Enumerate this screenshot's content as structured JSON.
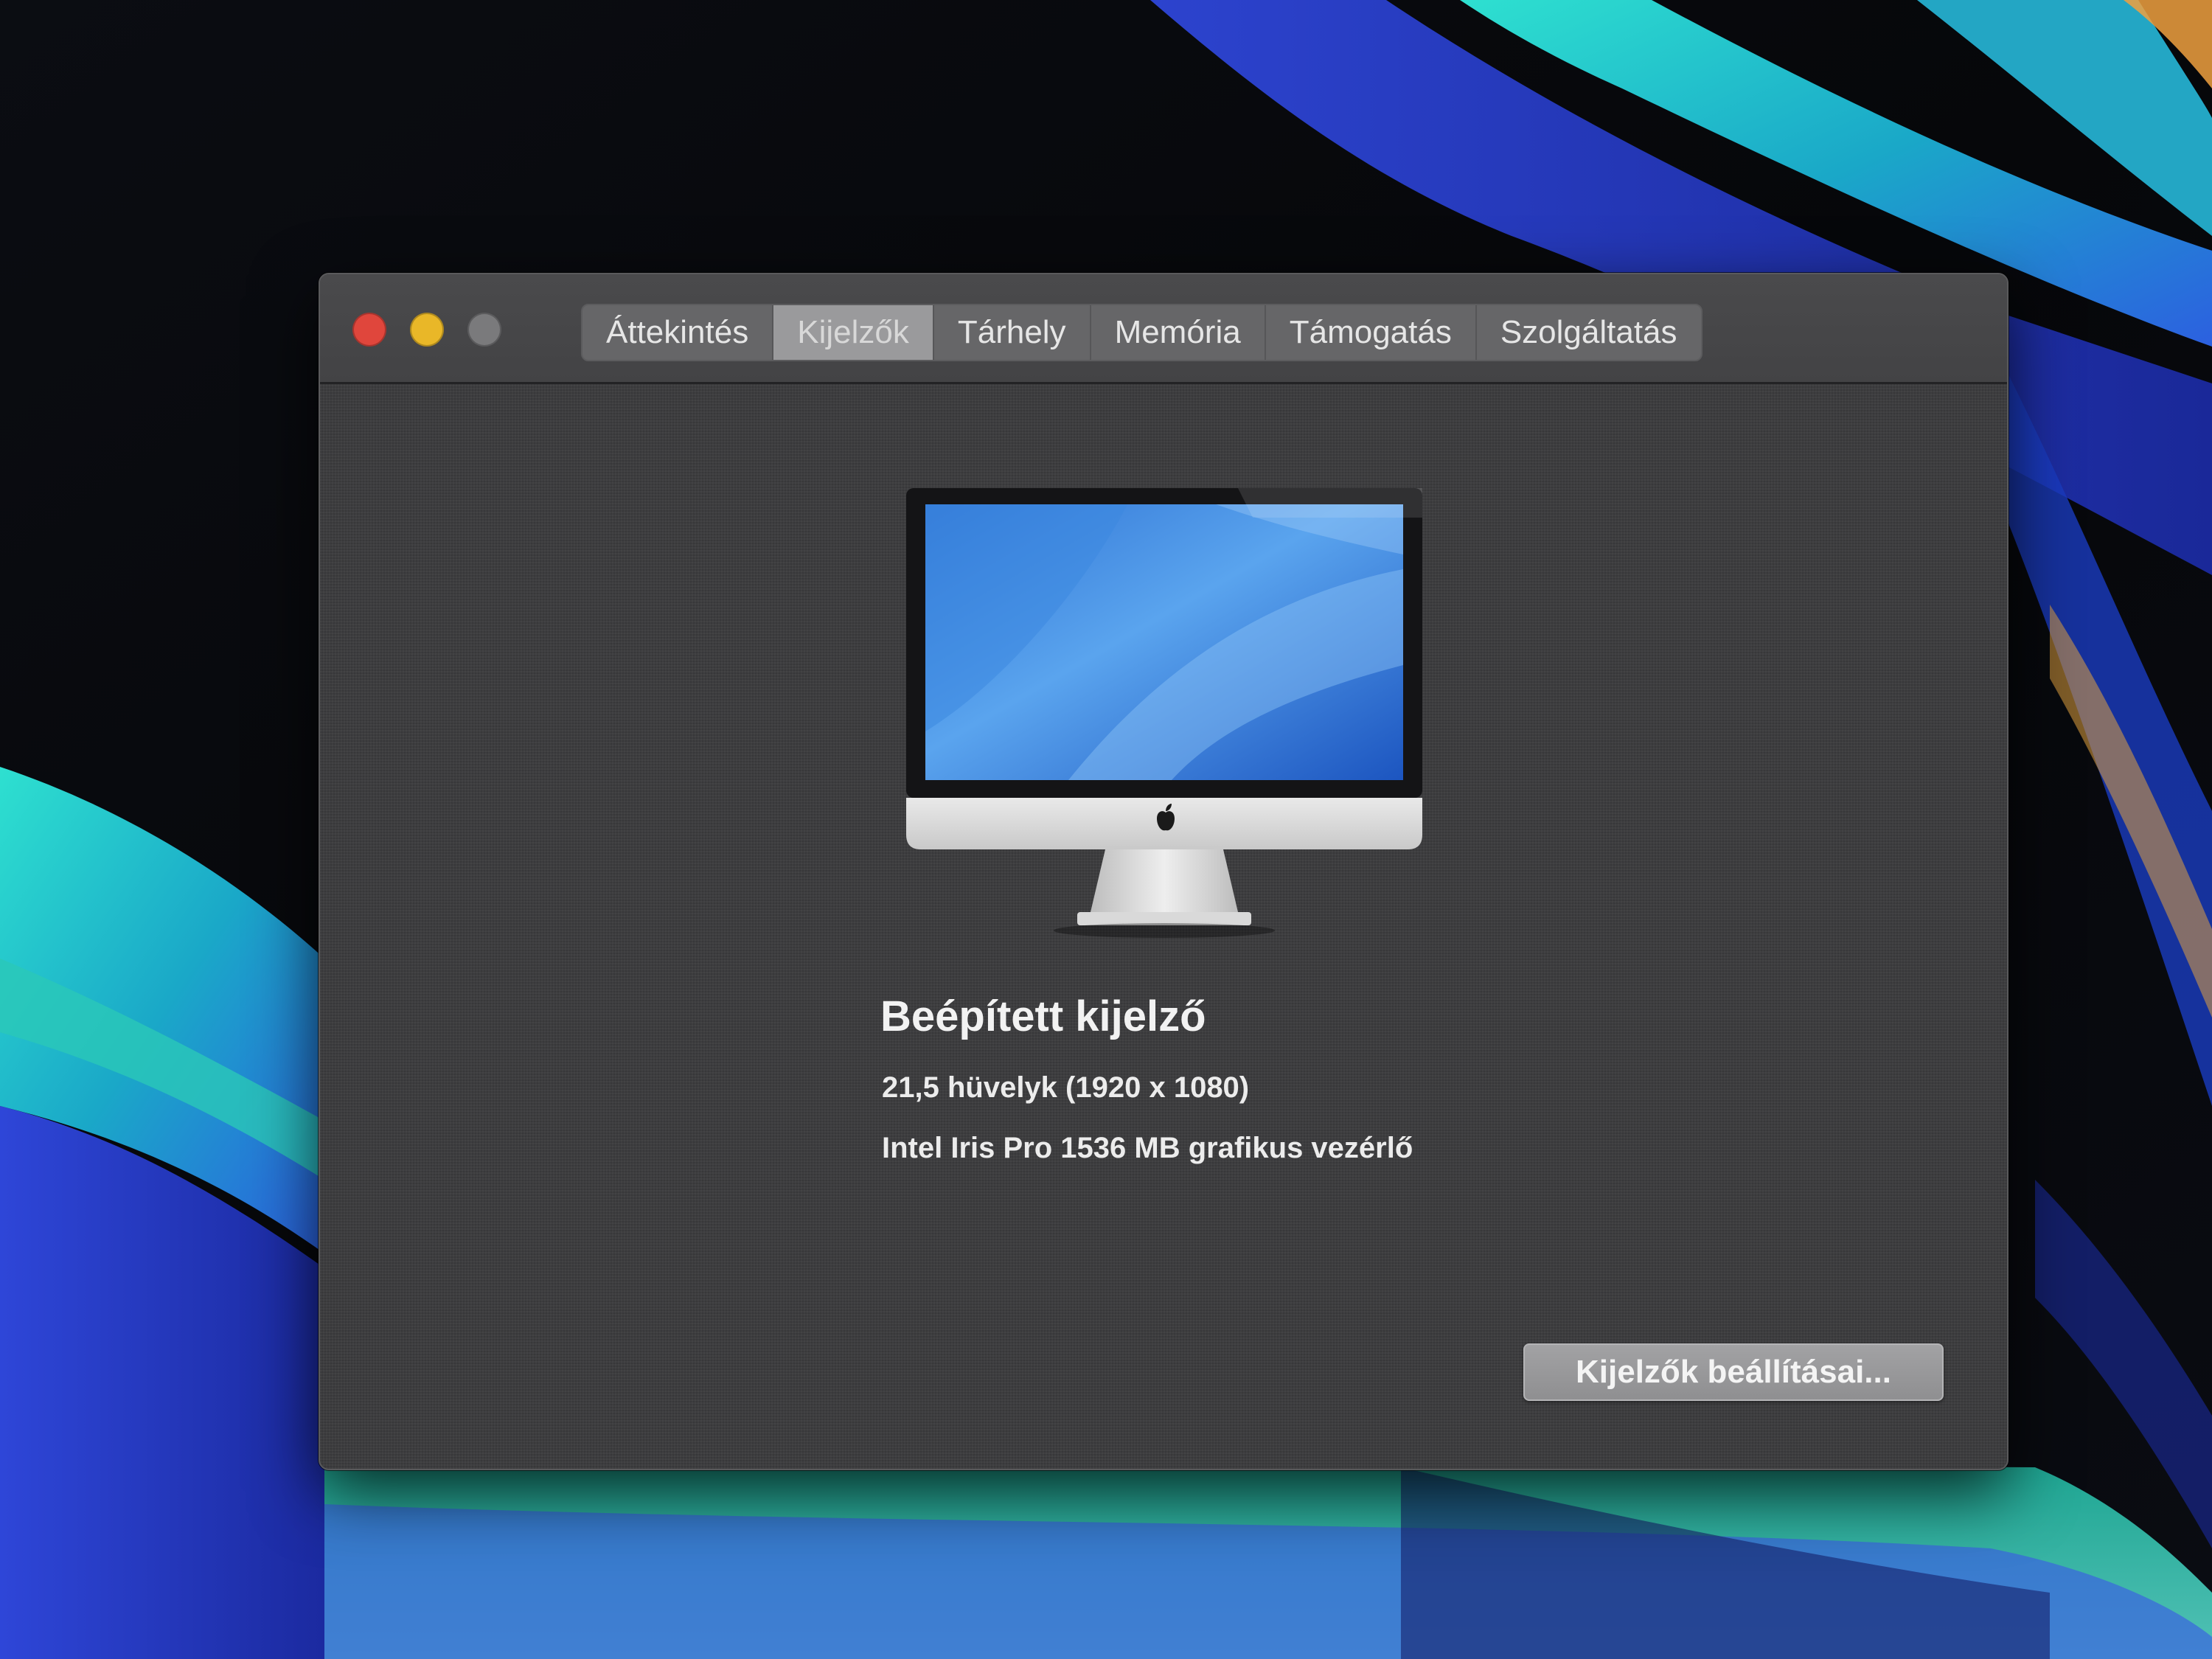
{
  "window": {
    "tabs": [
      {
        "label": "Áttekintés",
        "active": false
      },
      {
        "label": "Kijelzők",
        "active": true
      },
      {
        "label": "Tárhely",
        "active": false
      },
      {
        "label": "Memória",
        "active": false
      },
      {
        "label": "Támogatás",
        "active": false
      },
      {
        "label": "Szolgáltatás",
        "active": false
      }
    ],
    "traffic_lights": {
      "close": "#e0463c",
      "minimize": "#e9b728",
      "zoom": "#7a7a7c"
    }
  },
  "display": {
    "image_icon": "imac-icon",
    "title": "Beépített kijelző",
    "size_resolution": "21,5 hüvelyk (1920 x 1080)",
    "graphics": "Intel Iris Pro 1536 MB grafikus vezérlő"
  },
  "actions": {
    "settings_button": "Kijelzők beállításai..."
  }
}
